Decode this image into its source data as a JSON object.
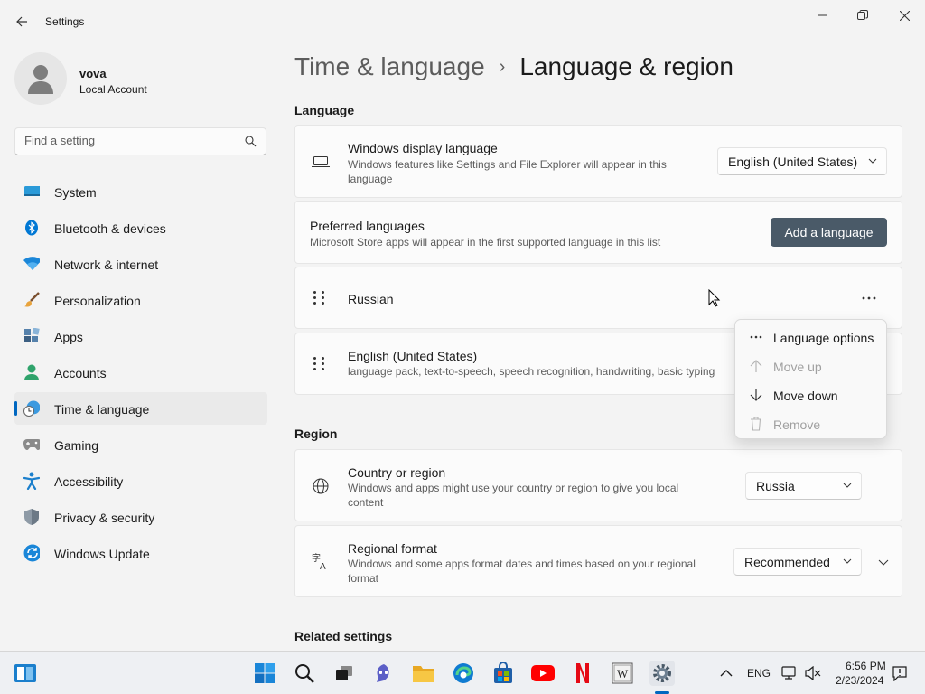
{
  "window": {
    "title": "Settings",
    "icons": {
      "back": "back-arrow-icon",
      "minimize": "minimize-icon",
      "maximize": "maximize-icon",
      "close": "close-icon"
    }
  },
  "profile": {
    "name": "vova",
    "account_type": "Local Account"
  },
  "search": {
    "placeholder": "Find a setting"
  },
  "sidebar": {
    "items": [
      {
        "label": "System",
        "icon": "system-icon"
      },
      {
        "label": "Bluetooth & devices",
        "icon": "bluetooth-icon"
      },
      {
        "label": "Network & internet",
        "icon": "wifi-icon"
      },
      {
        "label": "Personalization",
        "icon": "brush-icon"
      },
      {
        "label": "Apps",
        "icon": "apps-icon"
      },
      {
        "label": "Accounts",
        "icon": "accounts-icon"
      },
      {
        "label": "Time & language",
        "icon": "time-language-icon",
        "selected": true
      },
      {
        "label": "Gaming",
        "icon": "gamepad-icon"
      },
      {
        "label": "Accessibility",
        "icon": "accessibility-icon"
      },
      {
        "label": "Privacy & security",
        "icon": "shield-icon"
      },
      {
        "label": "Windows Update",
        "icon": "update-icon"
      }
    ]
  },
  "breadcrumb": {
    "parent": "Time & language",
    "separator": "›",
    "current": "Language & region"
  },
  "language_section": {
    "title": "Language",
    "display_language": {
      "title": "Windows display language",
      "description": "Windows features like Settings and File Explorer will appear in this language",
      "value": "English (United States)"
    },
    "preferred": {
      "title": "Preferred languages",
      "description": "Microsoft Store apps will appear in the first supported language in this list",
      "add_button": "Add a language"
    },
    "languages": [
      {
        "name": "Russian",
        "details": ""
      },
      {
        "name": "English (United States)",
        "details": "language pack, text-to-speech, speech recognition, handwriting, basic typing"
      }
    ]
  },
  "context_menu": {
    "items": [
      {
        "label": "Language options",
        "icon": "more-icon",
        "enabled": true
      },
      {
        "label": "Move up",
        "icon": "arrow-up-icon",
        "enabled": false
      },
      {
        "label": "Move down",
        "icon": "arrow-down-icon",
        "enabled": true
      },
      {
        "label": "Remove",
        "icon": "trash-icon",
        "enabled": false
      }
    ]
  },
  "region_section": {
    "title": "Region",
    "country": {
      "title": "Country or region",
      "description": "Windows and apps might use your country or region to give you local content",
      "value": "Russia"
    },
    "format": {
      "title": "Regional format",
      "description": "Windows and some apps format dates and times based on your regional format",
      "value": "Recommended"
    }
  },
  "related": {
    "title": "Related settings"
  },
  "taskbar": {
    "apps": [
      "widgets-icon",
      "start-icon",
      "search-icon",
      "task-view-icon",
      "chat-icon",
      "file-explorer-icon",
      "edge-icon",
      "store-icon",
      "youtube-icon",
      "netflix-icon",
      "wikipedia-icon",
      "settings-icon"
    ],
    "tray": {
      "language": "ENG",
      "time": "6:56 PM",
      "date": "2/23/2024"
    }
  },
  "colors": {
    "accent": "#0067c0",
    "button": "#4a5a68"
  }
}
